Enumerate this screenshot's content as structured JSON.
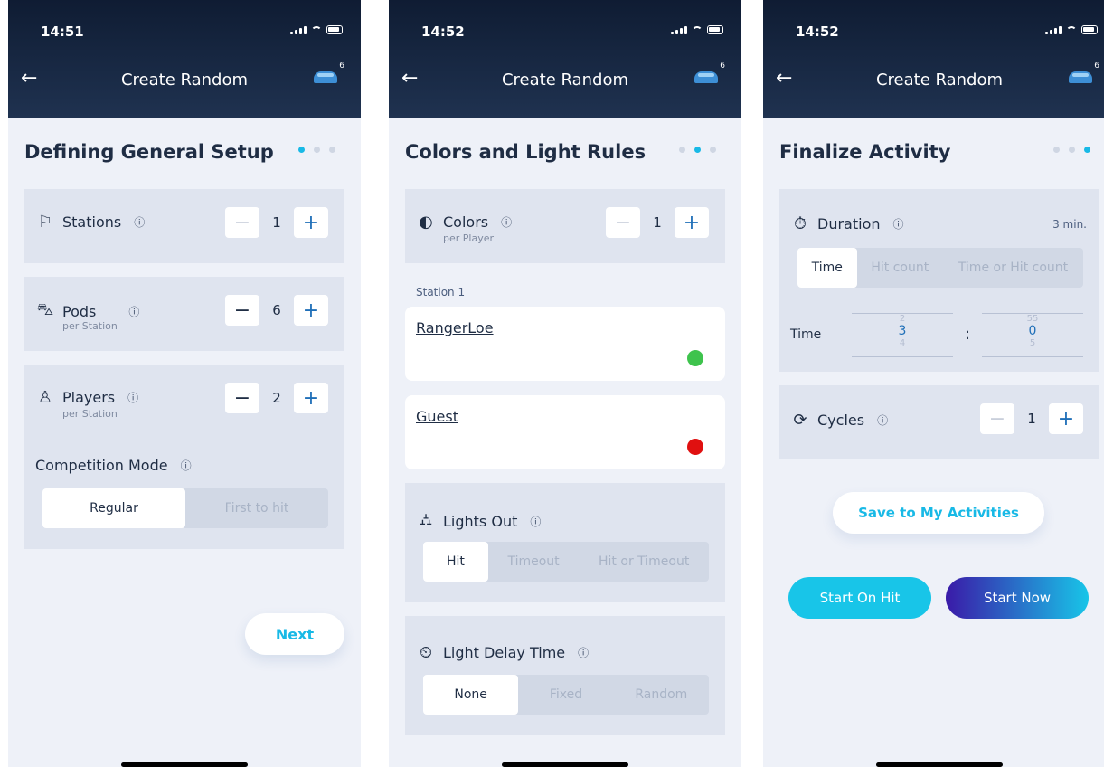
{
  "screens": [
    {
      "status_time": "14:51",
      "header_title": "Create Random",
      "pods_badge": "6",
      "page_title": "Defining General Setup",
      "stations": {
        "label": "Stations",
        "value": "1"
      },
      "pods": {
        "label": "Pods",
        "sub": "per Station",
        "value": "6"
      },
      "players": {
        "label": "Players",
        "sub": "per Station",
        "value": "2"
      },
      "competition": {
        "label": "Competition Mode",
        "options": [
          "Regular",
          "First to hit"
        ],
        "selected": "Regular"
      },
      "next_label": "Next",
      "active_step": 1
    },
    {
      "status_time": "14:52",
      "header_title": "Create Random",
      "pods_badge": "6",
      "page_title": "Colors and Light Rules",
      "colors": {
        "label": "Colors",
        "sub": "per Player",
        "value": "1"
      },
      "station_label": "Station 1",
      "players": [
        {
          "name": "RangerLoe",
          "color": "#3ec34d"
        },
        {
          "name": "Guest",
          "color": "#e01010"
        }
      ],
      "lights_out": {
        "label": "Lights Out",
        "options": [
          "Hit",
          "Timeout",
          "Hit or Timeout"
        ],
        "selected": "Hit"
      },
      "light_delay": {
        "label": "Light Delay Time",
        "options": [
          "None",
          "Fixed",
          "Random"
        ],
        "selected": "None"
      },
      "active_step": 2
    },
    {
      "status_time": "14:52",
      "header_title": "Create Random",
      "pods_badge": "6",
      "page_title": "Finalize Activity",
      "duration": {
        "label": "Duration",
        "value": "3 min.",
        "options": [
          "Time",
          "Hit count",
          "Time or Hit count"
        ],
        "selected": "Time"
      },
      "time_picker": {
        "label": "Time",
        "min_prev": "2",
        "min": "3",
        "min_next": "4",
        "sec_prev": "55",
        "sec": "0",
        "sec_next": "5",
        "separator": ":"
      },
      "cycles": {
        "label": "Cycles",
        "value": "1"
      },
      "save_label": "Save to My Activities",
      "start_on_hit_label": "Start On Hit",
      "start_now_label": "Start Now",
      "active_step": 3
    }
  ],
  "colors": {
    "accent": "#18b9e6",
    "header": "#16243d",
    "card": "#dfe4ef",
    "background": "#eef1f8"
  }
}
